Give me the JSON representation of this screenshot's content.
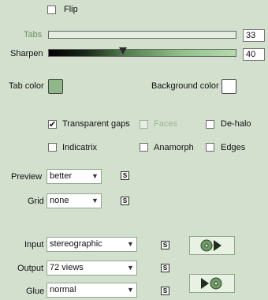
{
  "flip": {
    "label": "Flip",
    "checked": false
  },
  "tabs": {
    "label": "Tabs",
    "value": "33"
  },
  "sharpen": {
    "label": "Sharpen",
    "value": "40"
  },
  "tab_color": {
    "label": "Tab color",
    "color": "#8fb88a"
  },
  "background_color": {
    "label": "Background color",
    "color": "#ffffff"
  },
  "options": {
    "transparent_gaps": {
      "label": "Transparent gaps",
      "checked": true
    },
    "faces": {
      "label": "Faces",
      "checked": false
    },
    "de_halo": {
      "label": "De-halo",
      "checked": false
    },
    "indicatrix": {
      "label": "Indicatrix",
      "checked": false
    },
    "anamorph": {
      "label": "Anamorph",
      "checked": false
    },
    "edges": {
      "label": "Edges",
      "checked": false
    }
  },
  "preview": {
    "label": "Preview",
    "value": "better"
  },
  "grid": {
    "label": "Grid",
    "value": "none"
  },
  "input": {
    "label": "Input",
    "value": "stereographic"
  },
  "output": {
    "label": "Output",
    "value": "72 views"
  },
  "glue": {
    "label": "Glue",
    "value": "normal"
  },
  "s_label": "S",
  "check_glyph": "✔",
  "dropdown_glyph": "▼"
}
